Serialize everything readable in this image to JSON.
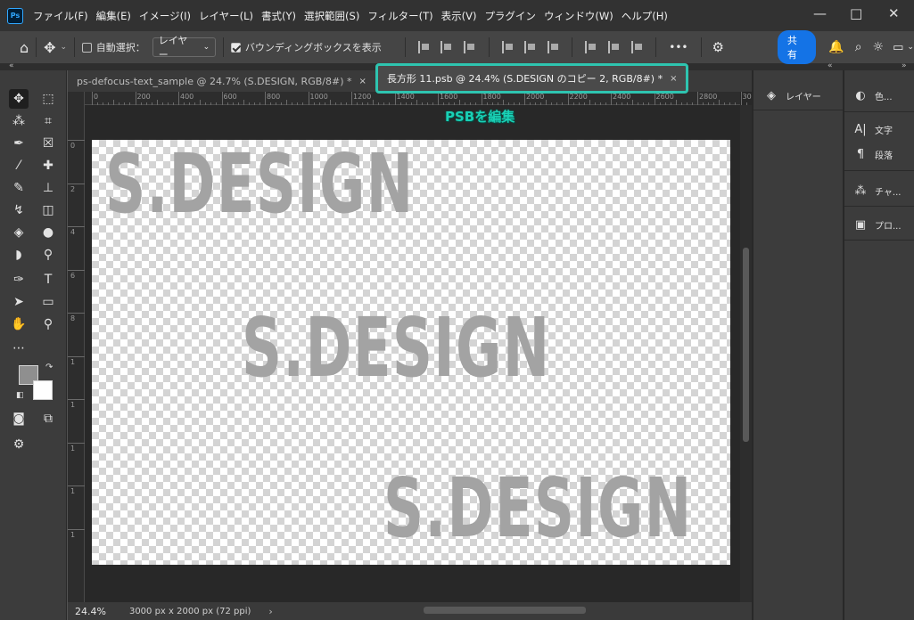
{
  "app": {
    "logo": "Ps"
  },
  "menu": [
    "ファイル(F)",
    "編集(E)",
    "イメージ(I)",
    "レイヤー(L)",
    "書式(Y)",
    "選択範囲(S)",
    "フィルター(T)",
    "表示(V)",
    "プラグイン",
    "ウィンドウ(W)",
    "ヘルプ(H)"
  ],
  "window_controls": {
    "minimize": "—",
    "maximize": "□",
    "close": "✕"
  },
  "options": {
    "auto_select_label": "自動選択：",
    "layer_select": "レイヤー",
    "bounding_box_label": "バウンディングボックスを表示",
    "more": "•••",
    "share": "共有"
  },
  "tabs": [
    {
      "label": "ps-defocus-text_sample @ 24.7% (S.DESIGN, RGB/8#) *",
      "close": "×"
    },
    {
      "label": "長方形 11.psb @ 24.4% (S.DESIGN のコピー 2, RGB/8#) *",
      "close": "×"
    }
  ],
  "ruler": {
    "h": [
      "0",
      "200",
      "400",
      "600",
      "800",
      "1000",
      "1200",
      "1400",
      "1600",
      "1800",
      "2000",
      "2200",
      "2400",
      "2600",
      "2800",
      "30"
    ],
    "v": [
      "0",
      "2",
      "4",
      "6",
      "8",
      "1",
      "1",
      "1",
      "1",
      "1"
    ]
  },
  "canvas": {
    "texts": [
      "S.DESIGN",
      "S.DESIGN",
      "S.DESIGN"
    ],
    "text_color": "#a3a3a3"
  },
  "callout": "PSBを編集",
  "status": {
    "zoom": "24.4%",
    "doc_size": "3000 px x 2000 px (72 ppi)",
    "arrow": "›"
  },
  "panels": {
    "mid": [
      {
        "icon": "layers-icon",
        "label": "レイヤー"
      }
    ],
    "right": [
      {
        "icon": "color-icon",
        "label": "色..."
      },
      {
        "icon": "character-icon",
        "label": "文字"
      },
      {
        "icon": "paragraph-icon",
        "label": "段落"
      },
      {
        "icon": "channels-icon",
        "label": "チャ..."
      },
      {
        "icon": "properties-icon",
        "label": "プロ..."
      }
    ]
  },
  "colors": {
    "accent": "#1473e6",
    "highlight": "#2ec4b0",
    "callout": "#19d0b5"
  }
}
